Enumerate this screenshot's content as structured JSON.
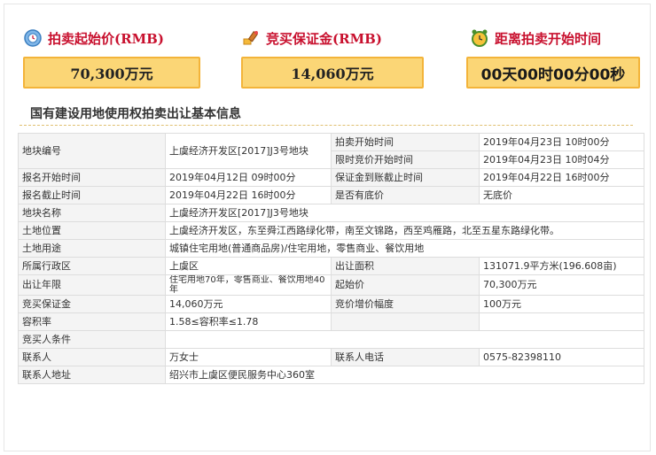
{
  "stats": {
    "start_price": {
      "label": "拍卖起始价(RMB)",
      "value": "70,300万元",
      "icon": "clock-coin-icon"
    },
    "deposit": {
      "label": "竞买保证金(RMB)",
      "value": "14,060万元",
      "icon": "bid-hammer-icon"
    },
    "countdown": {
      "label": "距离拍卖开始时间",
      "value": "00天00时00分00秒",
      "icon": "alarm-clock-icon"
    }
  },
  "section_title": "国有建设用地使用权拍卖出让基本信息",
  "table": {
    "plot_no_label": "地块编号",
    "plot_no": "上虞经济开发区[2017]J3号地块",
    "auction_start_label": "拍卖开始时间",
    "auction_start": "2019年04月23日 10时00分",
    "bid_start_label": "限时竞价开始时间",
    "bid_start": "2019年04月23日 10时04分",
    "reg_start_label": "报名开始时间",
    "reg_start": "2019年04月12日 09时00分",
    "deposit_deadline_label": "保证金到账截止时间",
    "deposit_deadline": "2019年04月22日 16时00分",
    "reg_end_label": "报名截止时间",
    "reg_end": "2019年04月22日 16时00分",
    "reserve_label": "是否有底价",
    "reserve": "无底价",
    "plot_name_label": "地块名称",
    "plot_name": "上虞经济开发区[2017]J3号地块",
    "location_label": "土地位置",
    "location": "上虞经济开发区，东至舜江西路绿化带，南至文锦路，西至鸡雁路，北至五星东路绿化带。",
    "usage_label": "土地用途",
    "usage": "城镇住宅用地(普通商品房)/住宅用地，零售商业、餐饮用地",
    "district_label": "所属行政区",
    "district": "上虞区",
    "area_label": "出让面积",
    "area": "131071.9平方米(196.608亩)",
    "term_label": "出让年限",
    "term": "住宅用地70年，零售商业、餐饮用地40年",
    "start_price_label": "起始价",
    "start_price": "70,300万元",
    "bid_deposit_label": "竞买保证金",
    "bid_deposit": "14,060万元",
    "increment_label": "竞价增价幅度",
    "increment": "100万元",
    "far_label": "容积率",
    "far": "1.58≤容积率≤1.78",
    "conditions_label": "竞买人条件",
    "conditions": "",
    "contact_label": "联系人",
    "contact": "万女士",
    "phone_label": "联系人电话",
    "phone": "0575-82398110",
    "address_label": "联系人地址",
    "address": "绍兴市上虞区便民服务中心360室"
  }
}
